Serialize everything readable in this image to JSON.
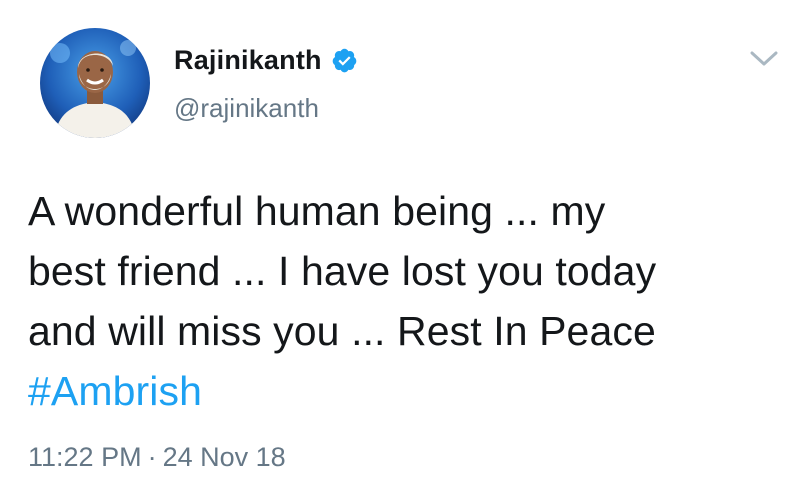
{
  "user": {
    "display_name": "Rajinikanth",
    "handle": "@rajinikanth",
    "verified": true,
    "avatar_icon": "profile-photo",
    "verified_icon": "verified-badge-icon"
  },
  "menu": {
    "icon": "chevron-down-icon"
  },
  "tweet": {
    "lines": [
      "A wonderful human being ... my",
      "best friend ... I have lost you today",
      "and will miss you ... Rest In Peace"
    ],
    "hashtag": "#Ambrish"
  },
  "meta": {
    "time": "11:22 PM",
    "separator": "·",
    "date": "24 Nov 18"
  },
  "colors": {
    "text": "#14171a",
    "secondary": "#657786",
    "link": "#1da1f2",
    "verified": "#1da1f2"
  }
}
